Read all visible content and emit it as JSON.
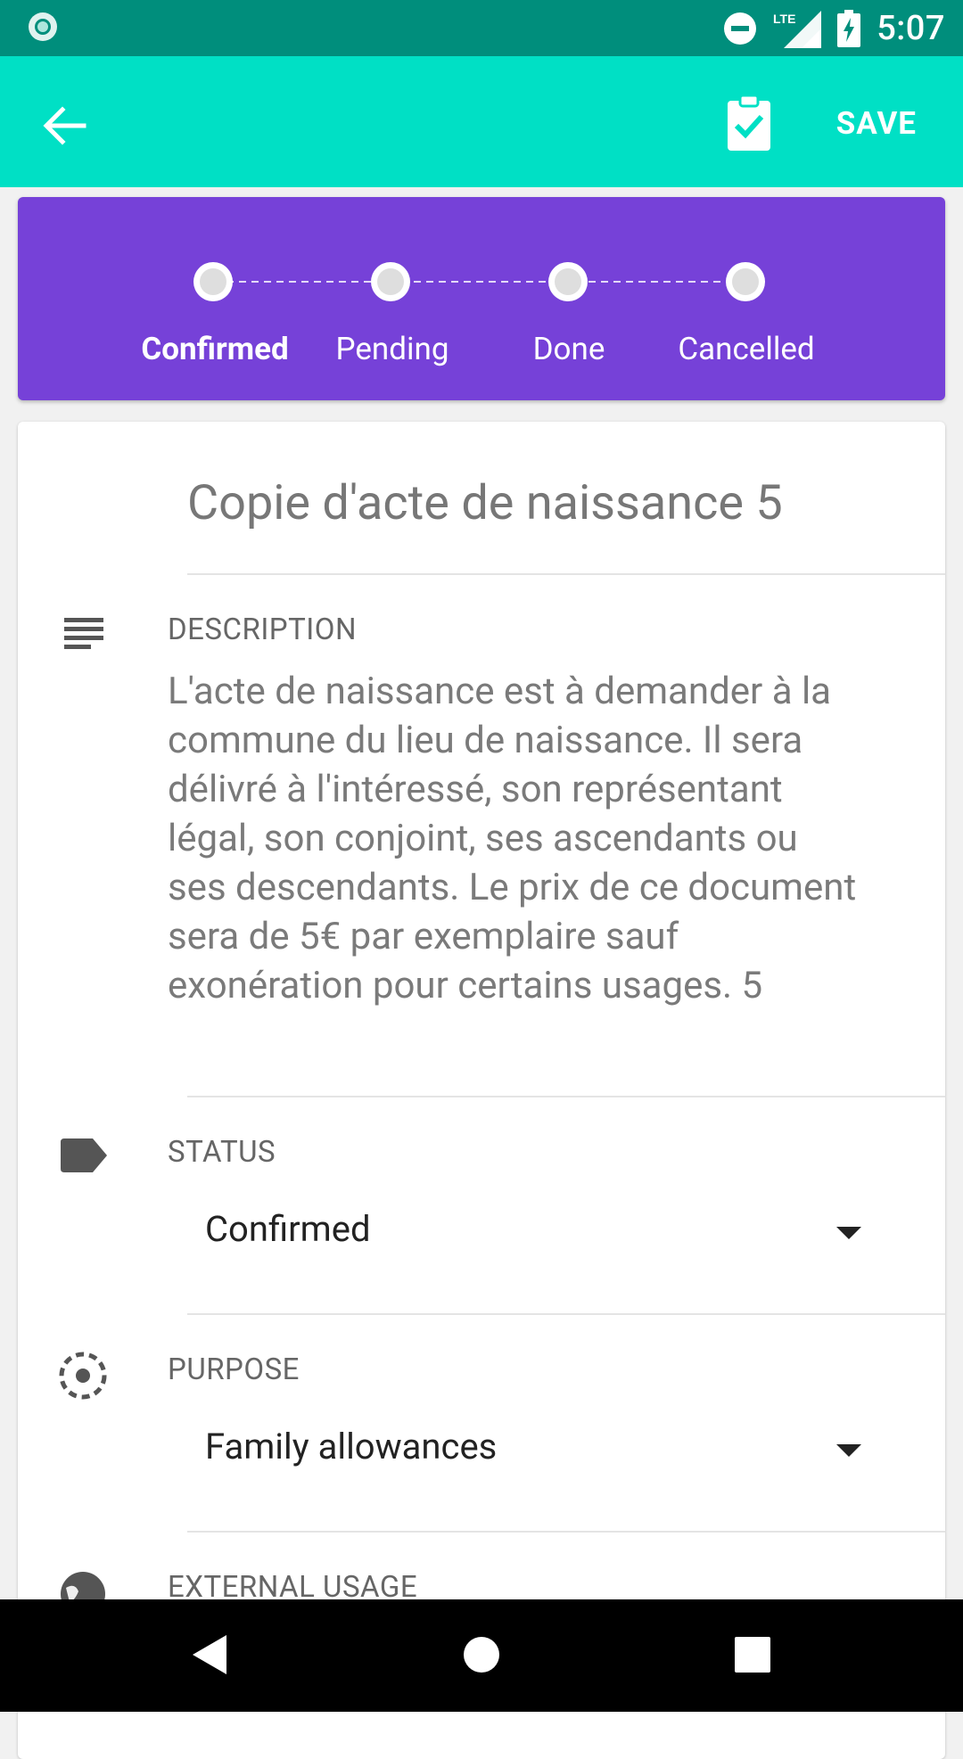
{
  "status_bar": {
    "time": "5:07",
    "network": "LTE",
    "icons": [
      "app-notification-icon",
      "do-not-disturb-icon",
      "signal-icon",
      "battery-charging-icon"
    ]
  },
  "app_bar": {
    "save_label": "SAVE",
    "icons": [
      "back-arrow-icon",
      "clipboard-check-icon"
    ],
    "color": "#00e0c5"
  },
  "stepper": {
    "color": "#7641d8",
    "steps": [
      {
        "label": "Confirmed",
        "active": true
      },
      {
        "label": "Pending",
        "active": false
      },
      {
        "label": "Done",
        "active": false
      },
      {
        "label": "Cancelled",
        "active": false
      }
    ]
  },
  "form": {
    "title": "Copie d'acte de naissance 5",
    "description": {
      "label": "DESCRIPTION",
      "text": "L'acte de naissance est à demander à la commune du lieu de naissance. Il sera délivré à l'intéressé, son représentant légal, son conjoint, ses ascendants ou ses descendants. Le prix de ce document sera de 5€ par exemplaire sauf exonération pour certains usages. 5",
      "icon": "notes-icon"
    },
    "status": {
      "label": "STATUS",
      "value": "Confirmed",
      "icon": "label-icon"
    },
    "purpose": {
      "label": "PURPOSE",
      "value": "Family allowances",
      "icon": "target-dashed-icon"
    },
    "external_usage": {
      "label": "EXTERNAL USAGE",
      "icon": "globe-icon"
    }
  }
}
